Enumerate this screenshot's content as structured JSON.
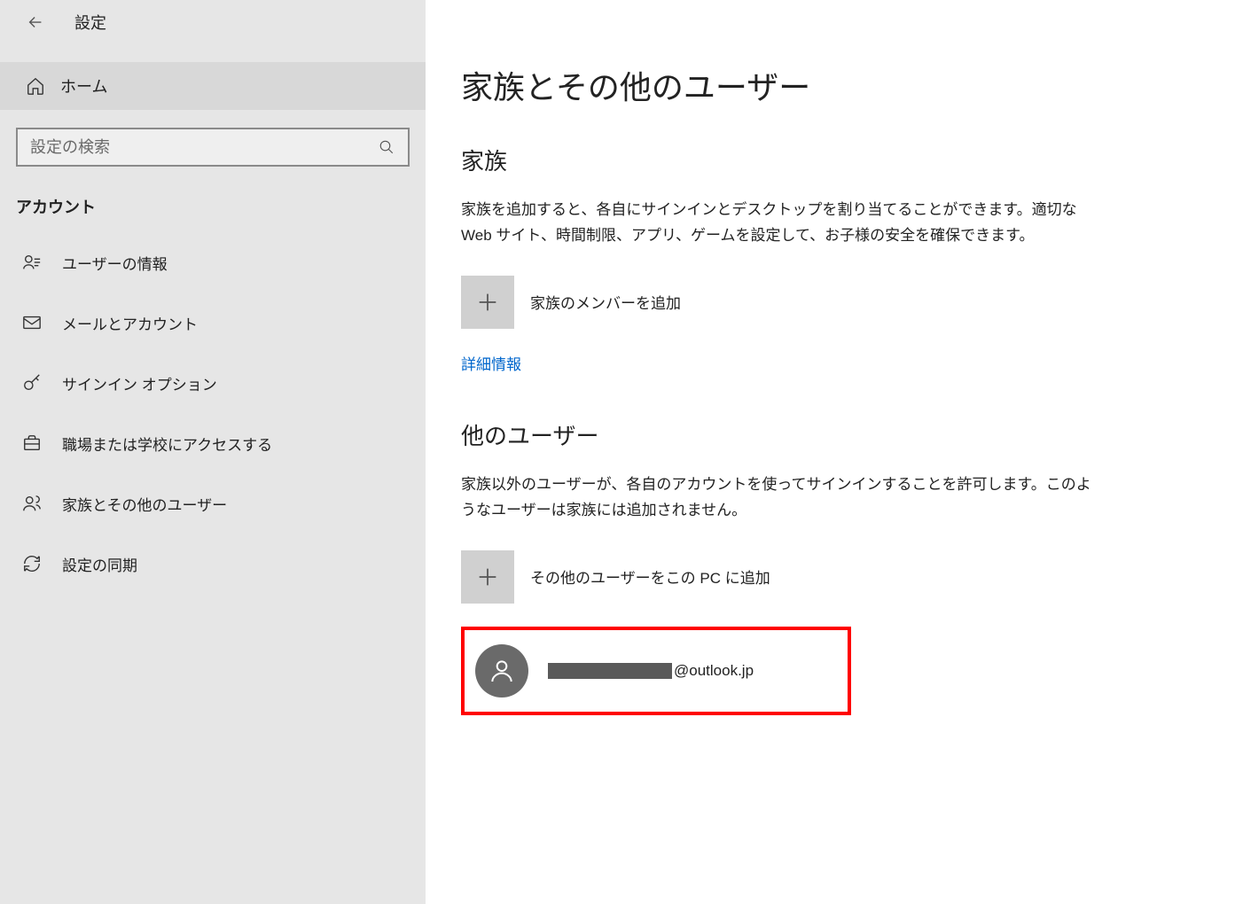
{
  "header": {
    "title": "設定"
  },
  "sidebar": {
    "home_label": "ホーム",
    "search_placeholder": "設定の検索",
    "category_label": "アカウント",
    "items": [
      {
        "label": "ユーザーの情報",
        "icon": "user-card"
      },
      {
        "label": "メールとアカウント",
        "icon": "mail"
      },
      {
        "label": "サインイン オプション",
        "icon": "key"
      },
      {
        "label": "職場または学校にアクセスする",
        "icon": "briefcase"
      },
      {
        "label": "家族とその他のユーザー",
        "icon": "people"
      },
      {
        "label": "設定の同期",
        "icon": "sync"
      }
    ]
  },
  "main": {
    "page_title": "家族とその他のユーザー",
    "family": {
      "title": "家族",
      "desc": "家族を追加すると、各自にサインインとデスクトップを割り当てることができます。適切な Web サイト、時間制限、アプリ、ゲームを設定して、お子様の安全を確保できます。",
      "add_label": "家族のメンバーを追加",
      "details_link": "詳細情報"
    },
    "others": {
      "title": "他のユーザー",
      "desc": "家族以外のユーザーが、各自のアカウントを使ってサインインすることを許可します。このようなユーザーは家族には追加されません。",
      "add_label": "その他のユーザーをこの PC に追加",
      "user_email_suffix": "@outlook.jp"
    }
  }
}
